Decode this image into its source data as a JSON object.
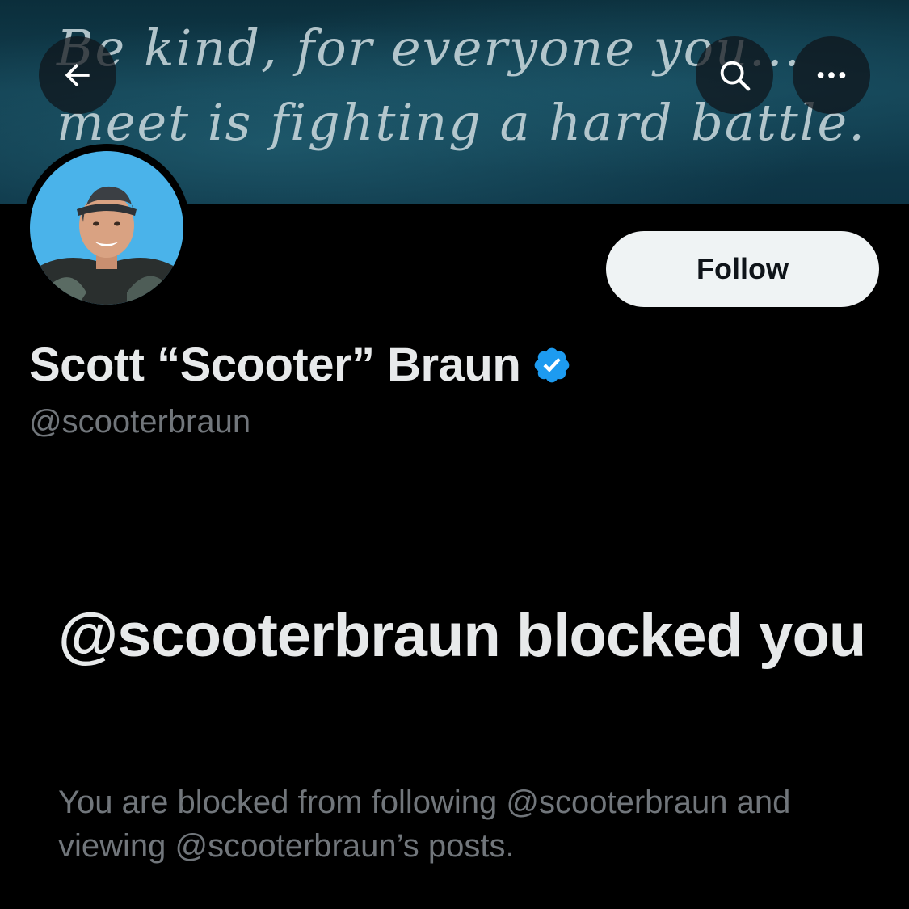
{
  "banner": {
    "quote_line1": "Be kind, for everyone you...",
    "quote_line2": "meet is fighting a hard battle."
  },
  "nav": {
    "back_icon": "arrow-left-icon",
    "search_icon": "search-icon",
    "more_icon": "more-horizontal-icon"
  },
  "profile": {
    "display_name": "Scott “Scooter” Braun",
    "handle": "@scooterbraun",
    "verified": true,
    "verified_color": "#1d9bf0",
    "follow_label": "Follow"
  },
  "blocked": {
    "title": "@scooterbraun blocked you",
    "description": "You are blocked from following @scooterbraun and viewing @scooterbraun’s posts."
  },
  "colors": {
    "background": "#000000",
    "primary_text": "#e7e9ea",
    "secondary_text": "#71767b",
    "follow_bg": "#eff3f4"
  }
}
